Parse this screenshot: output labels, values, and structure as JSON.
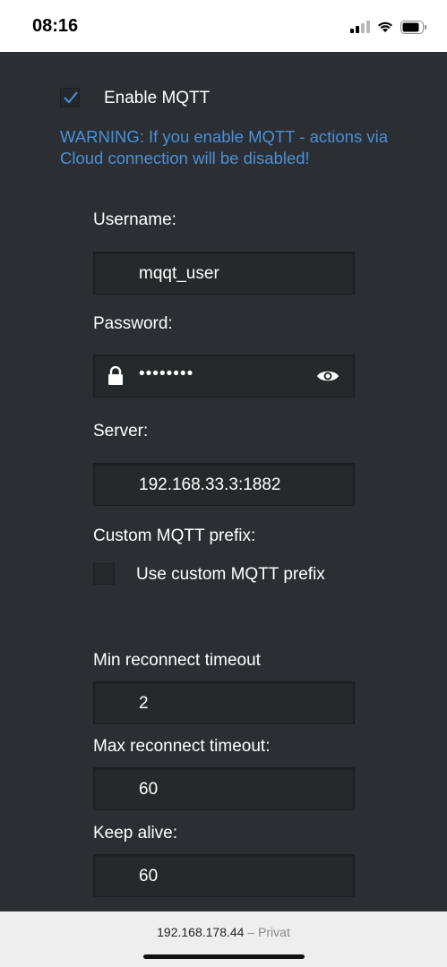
{
  "status_bar": {
    "time": "08:16",
    "icons": [
      "signal-icon",
      "wifi-icon",
      "battery-icon"
    ]
  },
  "mqtt": {
    "enable_label": "Enable MQTT",
    "enable_checked": true,
    "warning": "WARNING: If you enable MQTT - actions via Cloud connection will be disabled!",
    "warning_color": "#4a90d9"
  },
  "form": {
    "username_label": "Username:",
    "username_value": "mqqt_user",
    "password_label": "Password:",
    "password_value": "••••••••",
    "server_label": "Server:",
    "server_value": "192.168.33.3:1882",
    "custom_prefix_label": "Custom MQTT prefix:",
    "custom_prefix_checkbox_label": "Use custom MQTT prefix",
    "custom_prefix_checked": false,
    "min_reconnect_label": "Min reconnect timeout",
    "min_reconnect_value": "2",
    "max_reconnect_label": "Max reconnect timeout:",
    "max_reconnect_value": "60",
    "keep_alive_label": "Keep alive:",
    "keep_alive_value": "60"
  },
  "browser": {
    "url": "192.168.178.44",
    "separator": "–",
    "mode": "Privat"
  }
}
